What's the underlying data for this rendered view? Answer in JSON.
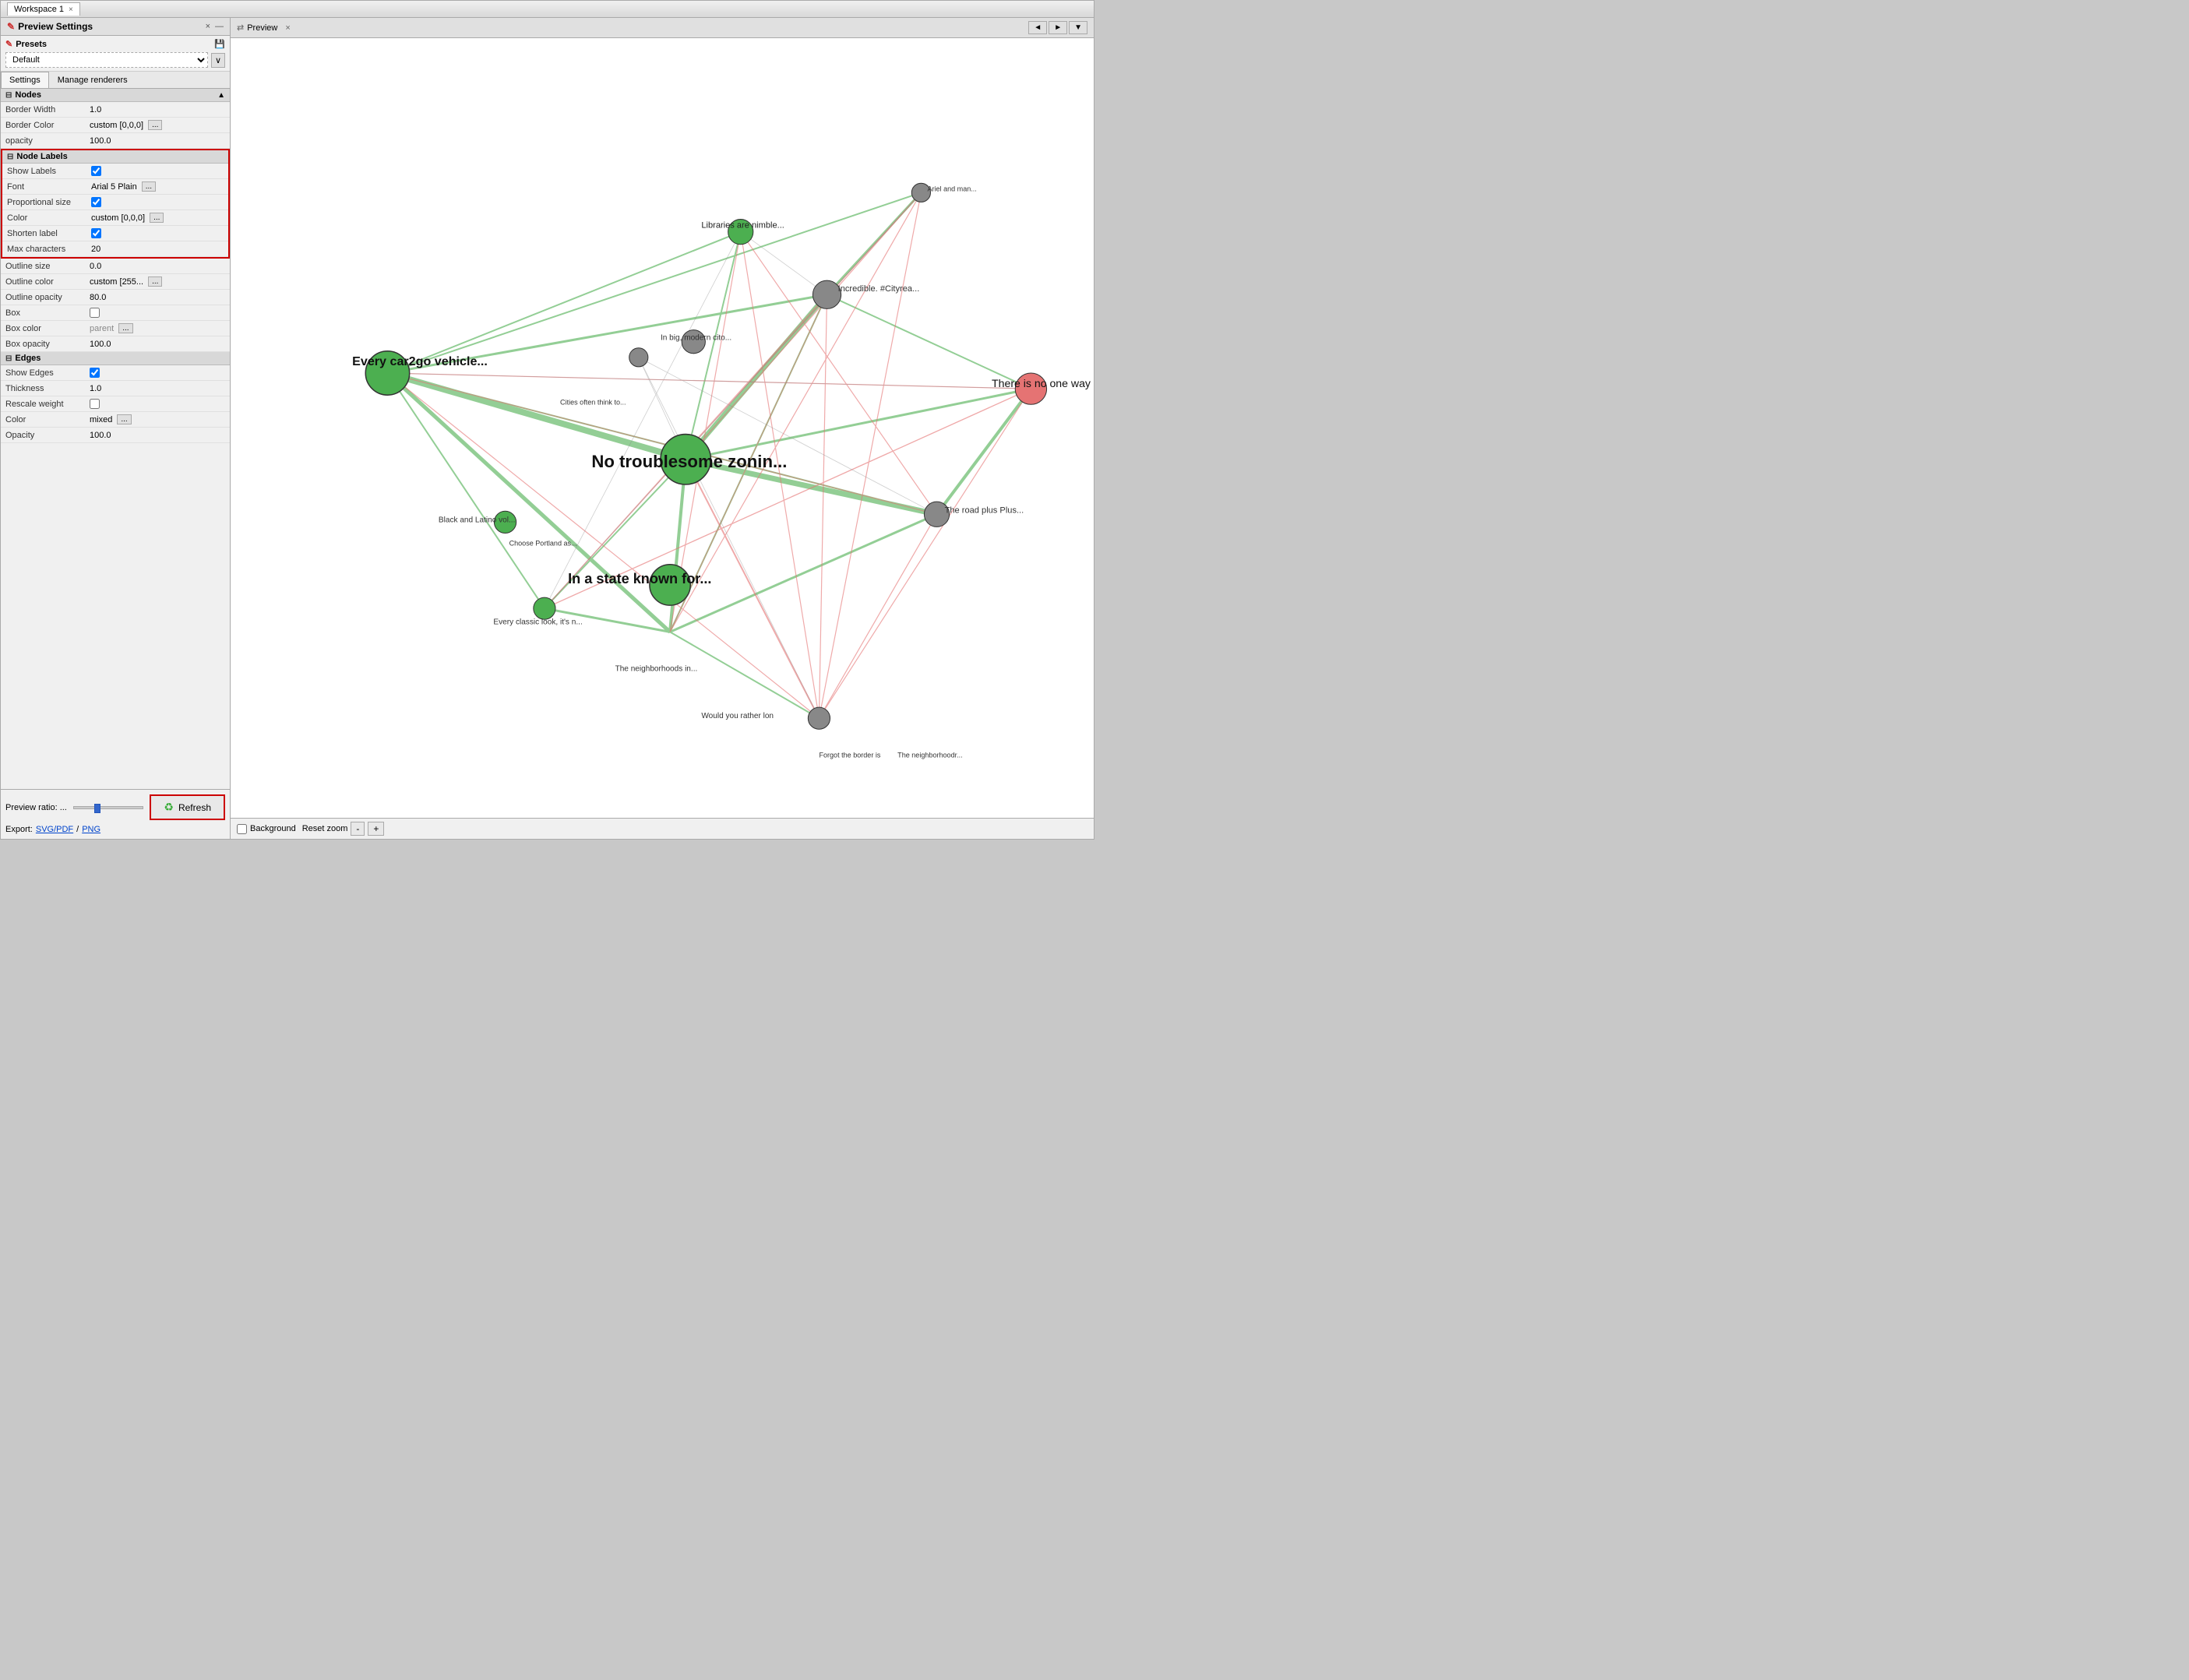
{
  "window": {
    "title": "Workspace 1",
    "close_label": "×"
  },
  "left_panel": {
    "title": "Preview Settings",
    "close_label": "×",
    "minimize_label": "—",
    "presets": {
      "label": "Presets",
      "save_tooltip": "Save",
      "dropdown_value": "Default",
      "dropdown_arrow": "∨"
    },
    "tabs": [
      {
        "label": "Settings",
        "active": true
      },
      {
        "label": "Manage renderers",
        "active": false
      }
    ],
    "nodes_section": {
      "label": "Nodes",
      "properties": [
        {
          "label": "Border Width",
          "value": "1.0"
        },
        {
          "label": "Border Color",
          "value": "custom [0,0,0]",
          "has_ellipsis": true
        },
        {
          "label": "opacity",
          "value": "100.0"
        }
      ]
    },
    "node_labels_section": {
      "label": "Node Labels",
      "highlighted": true,
      "properties": [
        {
          "label": "Show Labels",
          "value": "checkbox",
          "checked": true
        },
        {
          "label": "Font",
          "value": "Arial 5 Plain",
          "has_ellipsis": true
        },
        {
          "label": "Proportional size",
          "value": "checkbox",
          "checked": true
        },
        {
          "label": "Color",
          "value": "custom [0,0,0]",
          "has_ellipsis": true
        },
        {
          "label": "Shorten label",
          "value": "checkbox",
          "checked": true
        },
        {
          "label": "Max characters",
          "value": "20"
        }
      ]
    },
    "extra_properties": [
      {
        "label": "Outline size",
        "value": "0.0"
      },
      {
        "label": "Outline color",
        "value": "custom [255...",
        "has_ellipsis": true
      },
      {
        "label": "Outline opacity",
        "value": "80.0"
      },
      {
        "label": "Box",
        "value": "checkbox",
        "checked": false
      },
      {
        "label": "Box color",
        "value": "parent",
        "has_ellipsis": true
      },
      {
        "label": "Box opacity",
        "value": "100.0"
      }
    ],
    "edges_section": {
      "label": "Edges",
      "properties": [
        {
          "label": "Show Edges",
          "value": "checkbox",
          "checked": true
        },
        {
          "label": "Thickness",
          "value": "1.0"
        },
        {
          "label": "Rescale weight",
          "value": "checkbox",
          "checked": false
        },
        {
          "label": "Color",
          "value": "mixed",
          "has_ellipsis": true
        },
        {
          "label": "Opacity",
          "value": "100.0"
        }
      ]
    },
    "preview_ratio": {
      "label": "Preview ratio: ...",
      "slider_percent": 30
    },
    "refresh_button": "Refresh",
    "export": {
      "label": "Export:",
      "links": [
        "SVG/PDF",
        "PNG"
      ]
    }
  },
  "right_panel": {
    "title": "Preview",
    "close_label": "×",
    "nav_back": "◄",
    "nav_forward": "►",
    "nav_menu": "▼"
  },
  "bottom_toolbar": {
    "background_label": "Background",
    "reset_zoom_label": "Reset zoom",
    "zoom_minus": "-",
    "zoom_plus": "+"
  },
  "graph": {
    "labels": [
      "Every car2go vehicle...",
      "Libraries are nimble...",
      "No troublesome zonin...",
      "In a state known for...",
      "There is no one way .",
      "Black and Latino vol...",
      "In big, modern cito...",
      "Incredible. #Cityrea...",
      "Every classic look, it's n...",
      "The neighborhoods in...",
      "Would you rather lon",
      "Forgot the border is",
      "The neighborhoodr..."
    ],
    "node_colors": [
      "#4caf50",
      "#4caf50",
      "#4caf50",
      "#4caf50",
      "#888888"
    ],
    "edge_colors": [
      "#4caf50",
      "#e57373",
      "#888888"
    ]
  }
}
